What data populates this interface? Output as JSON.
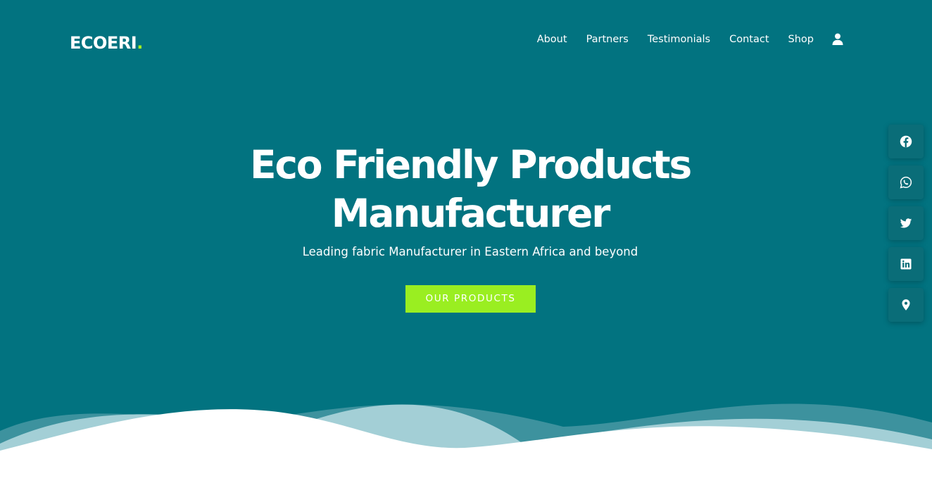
{
  "brand": {
    "name": "ECOERI",
    "dot": ".",
    "accent_color": "#a6f021"
  },
  "nav": {
    "items": [
      {
        "label": "About"
      },
      {
        "label": "Partners"
      },
      {
        "label": "Testimonials"
      },
      {
        "label": "Contact"
      },
      {
        "label": "Shop"
      }
    ],
    "account_icon": "user-icon"
  },
  "hero": {
    "title_line1": "Eco Friendly Products",
    "title_line2": "Manufacturer",
    "subtitle": "Leading fabric Manufacturer in Eastern Africa and beyond",
    "cta_label": "OUR PRODUCTS",
    "background_color": "#027380",
    "cta_color": "#9aee21"
  },
  "social_links": [
    {
      "icon": "facebook-icon"
    },
    {
      "icon": "whatsapp-icon"
    },
    {
      "icon": "twitter-icon"
    },
    {
      "icon": "linkedin-icon"
    },
    {
      "icon": "map-pin-icon"
    }
  ]
}
